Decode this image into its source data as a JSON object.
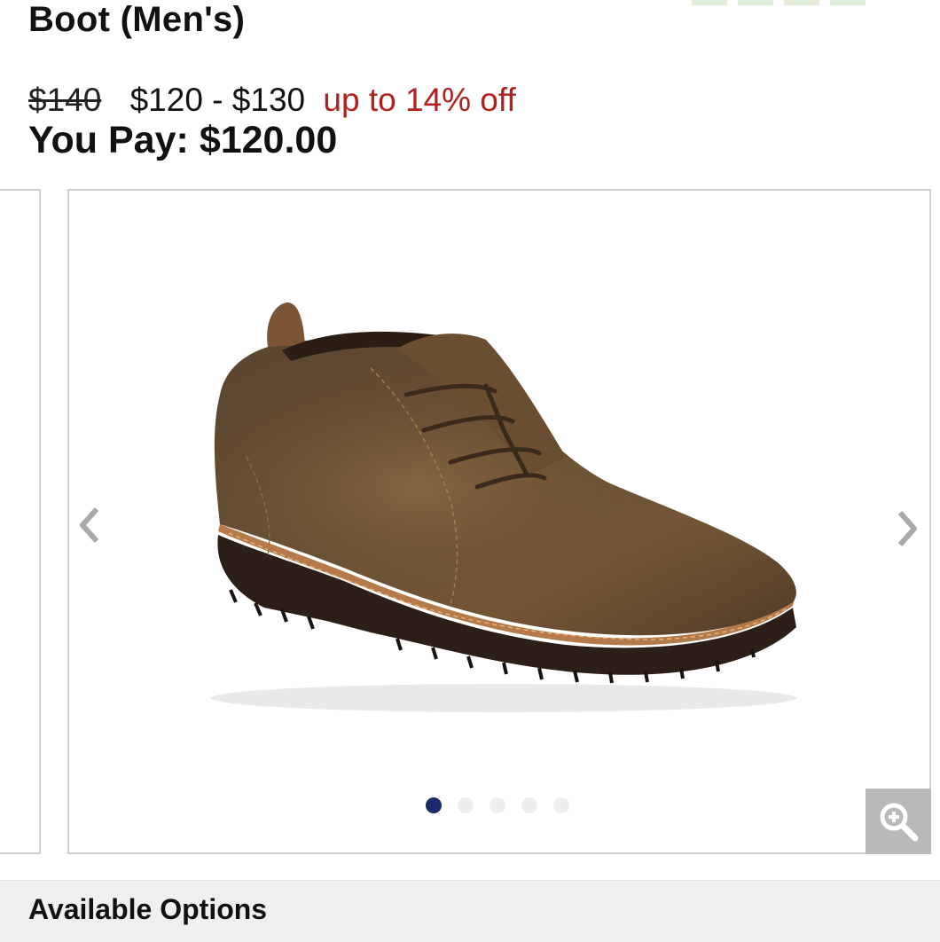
{
  "product": {
    "title": "Boot (Men's)",
    "original_price": "$140",
    "price_range": "$120 - $130",
    "discount": "up to 14% off",
    "you_pay_label": "You Pay:",
    "you_pay_value": "$120.00"
  },
  "carousel": {
    "image_subject": "brown leather chukka boot",
    "dot_count": 5,
    "active_dot": 0,
    "prev_icon": "chevron-left-icon",
    "next_icon": "chevron-right-icon",
    "zoom_icon": "zoom-in-icon"
  },
  "colors": {
    "discount": "#b0201d",
    "active_dot": "#1c2a6b",
    "zoom_bg": "#b9b9b9"
  },
  "sections": {
    "available_options": "Available Options"
  }
}
